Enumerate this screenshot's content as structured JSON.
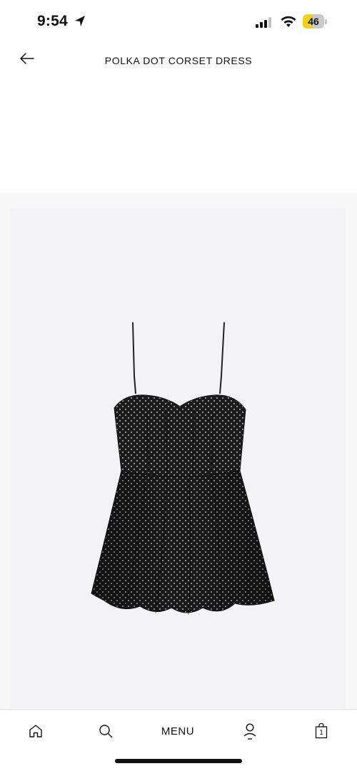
{
  "status_bar": {
    "time": "9:54",
    "battery_level": "46",
    "battery_fraction": 0.46,
    "battery_color": "#f2d11a",
    "icons": [
      "location-arrow-icon",
      "cellular-signal-icon",
      "wifi-icon",
      "battery-icon"
    ]
  },
  "header": {
    "title": "POLKA DOT CORSET DRESS",
    "back_icon": "arrow-left-icon"
  },
  "product_image": {
    "subject": "black polka dot corset mini dress",
    "background_color": "#f3f3f6"
  },
  "bottom_nav": {
    "items": [
      {
        "icon": "home-icon"
      },
      {
        "icon": "search-icon"
      },
      {
        "label": "MENU"
      },
      {
        "icon": "account-icon"
      },
      {
        "icon": "shopping-bag-icon",
        "count": "1"
      }
    ]
  }
}
